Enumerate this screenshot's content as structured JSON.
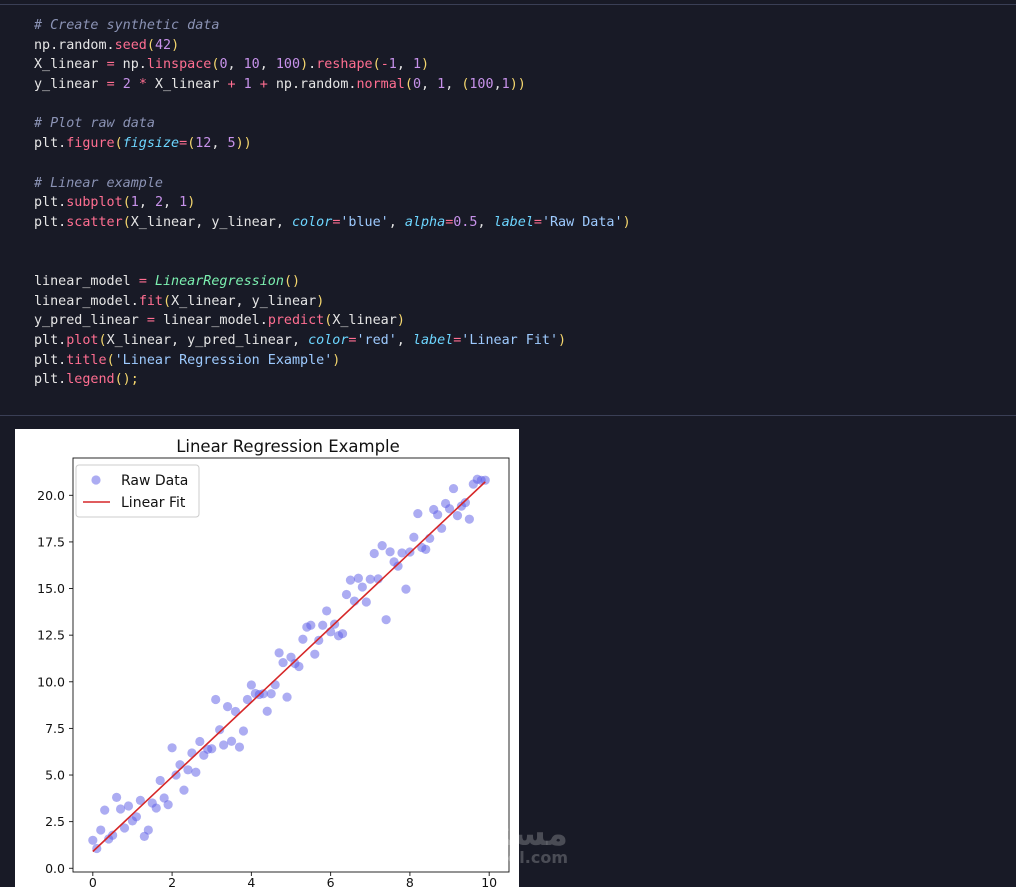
{
  "code": {
    "lines": [
      [
        {
          "t": "# Create synthetic data",
          "c": "comment"
        }
      ],
      [
        {
          "t": "np.random."
        },
        {
          "t": "seed",
          "c": "fn"
        },
        {
          "t": "(",
          "c": "par"
        },
        {
          "t": "42",
          "c": "num"
        },
        {
          "t": ")",
          "c": "par"
        }
      ],
      [
        {
          "t": "X_linear "
        },
        {
          "t": "=",
          "c": "op"
        },
        {
          "t": " np."
        },
        {
          "t": "linspace",
          "c": "fn"
        },
        {
          "t": "(",
          "c": "par"
        },
        {
          "t": "0",
          "c": "num"
        },
        {
          "t": ", "
        },
        {
          "t": "10",
          "c": "num"
        },
        {
          "t": ", "
        },
        {
          "t": "100",
          "c": "num"
        },
        {
          "t": ")",
          "c": "par"
        },
        {
          "t": "."
        },
        {
          "t": "reshape",
          "c": "fn"
        },
        {
          "t": "(",
          "c": "par"
        },
        {
          "t": "-",
          "c": "op"
        },
        {
          "t": "1",
          "c": "num"
        },
        {
          "t": ", "
        },
        {
          "t": "1",
          "c": "num"
        },
        {
          "t": ")",
          "c": "par"
        }
      ],
      [
        {
          "t": "y_linear "
        },
        {
          "t": "=",
          "c": "op"
        },
        {
          "t": " "
        },
        {
          "t": "2",
          "c": "num"
        },
        {
          "t": " "
        },
        {
          "t": "*",
          "c": "op"
        },
        {
          "t": " X_linear "
        },
        {
          "t": "+",
          "c": "op"
        },
        {
          "t": " "
        },
        {
          "t": "1",
          "c": "num"
        },
        {
          "t": " "
        },
        {
          "t": "+",
          "c": "op"
        },
        {
          "t": " np.random."
        },
        {
          "t": "normal",
          "c": "fn"
        },
        {
          "t": "(",
          "c": "par"
        },
        {
          "t": "0",
          "c": "num"
        },
        {
          "t": ", "
        },
        {
          "t": "1",
          "c": "num"
        },
        {
          "t": ", "
        },
        {
          "t": "(",
          "c": "par"
        },
        {
          "t": "100",
          "c": "num"
        },
        {
          "t": ","
        },
        {
          "t": "1",
          "c": "num"
        },
        {
          "t": "))",
          "c": "par"
        }
      ],
      [],
      [
        {
          "t": "# Plot raw data",
          "c": "comment"
        }
      ],
      [
        {
          "t": "plt."
        },
        {
          "t": "figure",
          "c": "fn"
        },
        {
          "t": "(",
          "c": "par"
        },
        {
          "t": "figsize",
          "c": "kw"
        },
        {
          "t": "=",
          "c": "op"
        },
        {
          "t": "(",
          "c": "par"
        },
        {
          "t": "12",
          "c": "num"
        },
        {
          "t": ", "
        },
        {
          "t": "5",
          "c": "num"
        },
        {
          "t": "))",
          "c": "par"
        }
      ],
      [],
      [
        {
          "t": "# Linear example",
          "c": "comment"
        }
      ],
      [
        {
          "t": "plt."
        },
        {
          "t": "subplot",
          "c": "fn"
        },
        {
          "t": "(",
          "c": "par"
        },
        {
          "t": "1",
          "c": "num"
        },
        {
          "t": ", "
        },
        {
          "t": "2",
          "c": "num"
        },
        {
          "t": ", "
        },
        {
          "t": "1",
          "c": "num"
        },
        {
          "t": ")",
          "c": "par"
        }
      ],
      [
        {
          "t": "plt."
        },
        {
          "t": "scatter",
          "c": "fn"
        },
        {
          "t": "(",
          "c": "par"
        },
        {
          "t": "X_linear, y_linear, "
        },
        {
          "t": "color",
          "c": "kw"
        },
        {
          "t": "=",
          "c": "op"
        },
        {
          "t": "'blue'",
          "c": "str"
        },
        {
          "t": ", "
        },
        {
          "t": "alpha",
          "c": "kw"
        },
        {
          "t": "=",
          "c": "op"
        },
        {
          "t": "0.5",
          "c": "num"
        },
        {
          "t": ", "
        },
        {
          "t": "label",
          "c": "kw"
        },
        {
          "t": "=",
          "c": "op"
        },
        {
          "t": "'Raw Data'",
          "c": "str"
        },
        {
          "t": ")",
          "c": "par"
        }
      ],
      [],
      [],
      [
        {
          "t": "linear_model "
        },
        {
          "t": "=",
          "c": "op"
        },
        {
          "t": " "
        },
        {
          "t": "LinearRegression",
          "c": "cls"
        },
        {
          "t": "()",
          "c": "par"
        }
      ],
      [
        {
          "t": "linear_model."
        },
        {
          "t": "fit",
          "c": "fn"
        },
        {
          "t": "(",
          "c": "par"
        },
        {
          "t": "X_linear, y_linear"
        },
        {
          "t": ")",
          "c": "par"
        }
      ],
      [
        {
          "t": "y_pred_linear "
        },
        {
          "t": "=",
          "c": "op"
        },
        {
          "t": " linear_model."
        },
        {
          "t": "predict",
          "c": "fn"
        },
        {
          "t": "(",
          "c": "par"
        },
        {
          "t": "X_linear"
        },
        {
          "t": ")",
          "c": "par"
        }
      ],
      [
        {
          "t": "plt."
        },
        {
          "t": "plot",
          "c": "fn"
        },
        {
          "t": "(",
          "c": "par"
        },
        {
          "t": "X_linear, y_pred_linear, "
        },
        {
          "t": "color",
          "c": "kw"
        },
        {
          "t": "=",
          "c": "op"
        },
        {
          "t": "'red'",
          "c": "str"
        },
        {
          "t": ", "
        },
        {
          "t": "label",
          "c": "kw"
        },
        {
          "t": "=",
          "c": "op"
        },
        {
          "t": "'Linear Fit'",
          "c": "str"
        },
        {
          "t": ")",
          "c": "par"
        }
      ],
      [
        {
          "t": "plt."
        },
        {
          "t": "title",
          "c": "fn"
        },
        {
          "t": "(",
          "c": "par"
        },
        {
          "t": "'Linear Regression Example'",
          "c": "str"
        },
        {
          "t": ")",
          "c": "par"
        }
      ],
      [
        {
          "t": "plt."
        },
        {
          "t": "legend",
          "c": "fn"
        },
        {
          "t": "();",
          "c": "par"
        }
      ]
    ]
  },
  "watermark": {
    "arabic": "مستقل",
    "latin": "mostaql.com"
  },
  "chart_data": {
    "type": "scatter",
    "title": "Linear Regression Example",
    "xlabel": "",
    "ylabel": "",
    "xlim": [
      -0.5,
      10.5
    ],
    "ylim": [
      -0.2,
      22.0
    ],
    "xticks": [
      0,
      2,
      4,
      6,
      8,
      10
    ],
    "yticks": [
      0.0,
      2.5,
      5.0,
      7.5,
      10.0,
      12.5,
      15.0,
      17.5,
      20.0
    ],
    "grid": false,
    "legend_position": "top-left",
    "series": [
      {
        "name": "Raw Data",
        "kind": "scatter",
        "color": "#5a5ae6",
        "alpha": 0.5,
        "points": [
          [
            0.0,
            1.5
          ],
          [
            0.1,
            1.06
          ],
          [
            0.2,
            2.05
          ],
          [
            0.3,
            3.12
          ],
          [
            0.4,
            1.57
          ],
          [
            0.5,
            1.77
          ],
          [
            0.6,
            3.8
          ],
          [
            0.7,
            3.18
          ],
          [
            0.8,
            2.16
          ],
          [
            0.9,
            3.34
          ],
          [
            1.0,
            2.54
          ],
          [
            1.1,
            2.76
          ],
          [
            1.2,
            3.64
          ],
          [
            1.3,
            1.71
          ],
          [
            1.4,
            2.05
          ],
          [
            1.5,
            3.5
          ],
          [
            1.6,
            3.23
          ],
          [
            1.7,
            4.71
          ],
          [
            1.8,
            3.77
          ],
          [
            1.9,
            3.41
          ],
          [
            2.0,
            6.46
          ],
          [
            2.1,
            5.0
          ],
          [
            2.2,
            5.55
          ],
          [
            2.3,
            4.19
          ],
          [
            2.4,
            5.28
          ],
          [
            2.5,
            6.18
          ],
          [
            2.6,
            5.15
          ],
          [
            2.7,
            6.8
          ],
          [
            2.8,
            6.06
          ],
          [
            2.9,
            6.38
          ],
          [
            3.0,
            6.41
          ],
          [
            3.1,
            9.05
          ],
          [
            3.2,
            7.43
          ],
          [
            3.3,
            6.61
          ],
          [
            3.4,
            8.67
          ],
          [
            3.5,
            6.81
          ],
          [
            3.6,
            8.41
          ],
          [
            3.7,
            6.5
          ],
          [
            3.8,
            7.36
          ],
          [
            3.9,
            9.05
          ],
          [
            4.0,
            9.83
          ],
          [
            4.1,
            9.37
          ],
          [
            4.2,
            9.32
          ],
          [
            4.3,
            9.36
          ],
          [
            4.4,
            8.42
          ],
          [
            4.5,
            9.36
          ],
          [
            4.6,
            9.84
          ],
          [
            4.7,
            11.55
          ],
          [
            4.8,
            11.03
          ],
          [
            4.9,
            9.18
          ],
          [
            5.0,
            11.32
          ],
          [
            5.1,
            10.98
          ],
          [
            5.2,
            10.82
          ],
          [
            5.3,
            12.28
          ],
          [
            5.4,
            12.93
          ],
          [
            5.5,
            13.03
          ],
          [
            5.6,
            11.48
          ],
          [
            5.7,
            12.22
          ],
          [
            5.8,
            13.03
          ],
          [
            5.9,
            13.8
          ],
          [
            6.0,
            12.68
          ],
          [
            6.1,
            13.09
          ],
          [
            6.2,
            12.47
          ],
          [
            6.3,
            12.58
          ],
          [
            6.4,
            14.68
          ],
          [
            6.5,
            15.45
          ],
          [
            6.6,
            14.33
          ],
          [
            6.7,
            15.55
          ],
          [
            6.8,
            15.08
          ],
          [
            6.9,
            14.28
          ],
          [
            7.0,
            15.5
          ],
          [
            7.1,
            16.88
          ],
          [
            7.2,
            15.52
          ],
          [
            7.3,
            17.3
          ],
          [
            7.4,
            13.33
          ],
          [
            7.5,
            16.97
          ],
          [
            7.6,
            16.43
          ],
          [
            7.7,
            16.2
          ],
          [
            7.8,
            16.91
          ],
          [
            7.9,
            14.97
          ],
          [
            8.0,
            16.96
          ],
          [
            8.1,
            17.75
          ],
          [
            8.2,
            19.02
          ],
          [
            8.3,
            17.2
          ],
          [
            8.4,
            17.1
          ],
          [
            8.5,
            17.69
          ],
          [
            8.6,
            19.24
          ],
          [
            8.7,
            18.96
          ],
          [
            8.8,
            18.23
          ],
          [
            8.9,
            19.56
          ],
          [
            9.0,
            19.28
          ],
          [
            9.1,
            20.36
          ],
          [
            9.2,
            18.91
          ],
          [
            9.3,
            19.42
          ],
          [
            9.4,
            19.61
          ],
          [
            9.5,
            18.72
          ],
          [
            9.6,
            20.6
          ],
          [
            9.7,
            20.86
          ],
          [
            9.8,
            20.8
          ],
          [
            9.9,
            20.81
          ]
        ]
      },
      {
        "name": "Linear Fit",
        "kind": "line",
        "color": "#d62728",
        "points": [
          [
            0.0,
            0.9
          ],
          [
            9.9,
            20.72
          ]
        ]
      }
    ]
  }
}
